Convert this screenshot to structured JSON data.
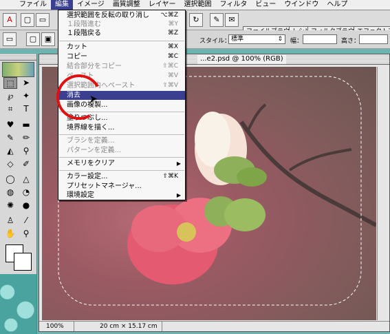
{
  "menubar": {
    "items": [
      "ファイル",
      "編集",
      "イメージ",
      "画質調整",
      "レイヤー",
      "選択範囲",
      "フィルタ",
      "ビュー",
      "ウインドウ",
      "ヘルプ"
    ],
    "active_index": 1
  },
  "toolbar": {
    "palette_tabs": [
      "ファイルブラウザ",
      "レシピ",
      "フィルタブラウザ",
      "エフェクトブ"
    ],
    "style_label": "スタイル：",
    "style_value": "標準",
    "width_label": "幅：",
    "height_label": "高さ："
  },
  "document": {
    "title": "...e2.psd @ 100% (RGB)",
    "zoom": "100%",
    "dimensions": "20 cm × 15.17 cm"
  },
  "edit_menu": {
    "items": [
      {
        "label": "選択範囲を反転の取り消し",
        "shortcut": "⌥⌘Z",
        "enabled": true
      },
      {
        "label": "１段階進む",
        "shortcut": "⌘Y",
        "enabled": false
      },
      {
        "label": "１段階戻る",
        "shortcut": "⌘Z",
        "enabled": true
      },
      {
        "label": "カット",
        "shortcut": "⌘X",
        "enabled": true
      },
      {
        "label": "コピー",
        "shortcut": "⌘C",
        "enabled": true
      },
      {
        "label": "結合部分をコピー",
        "shortcut": "⇧⌘C",
        "enabled": false
      },
      {
        "label": "ペースト",
        "shortcut": "⌘V",
        "enabled": false
      },
      {
        "label": "選択範囲内へペースト",
        "shortcut": "⇧⌘V",
        "enabled": false
      },
      {
        "label": "消去",
        "shortcut": "",
        "enabled": true,
        "highlighted": true
      },
      {
        "label": "画像の複製...",
        "shortcut": "",
        "enabled": true
      },
      {
        "label": "塗りつぶし...",
        "shortcut": "",
        "enabled": true
      },
      {
        "label": "境界線を描く...",
        "shortcut": "",
        "enabled": true
      },
      {
        "label": "ブラシを定義...",
        "shortcut": "",
        "enabled": false
      },
      {
        "label": "パターンを定義...",
        "shortcut": "",
        "enabled": false
      },
      {
        "label": "メモリをクリア",
        "shortcut": "",
        "enabled": true,
        "submenu": true
      },
      {
        "label": "カラー設定...",
        "shortcut": "⇧⌘K",
        "enabled": true
      },
      {
        "label": "プリセットマネージャ...",
        "shortcut": "",
        "enabled": true
      },
      {
        "label": "環境設定",
        "shortcut": "",
        "enabled": true,
        "submenu": true
      }
    ]
  },
  "colors": {
    "menu_highlight": "#3b3f8f",
    "annotation_circle": "#e01010",
    "desktop": "#6fb3b0"
  }
}
